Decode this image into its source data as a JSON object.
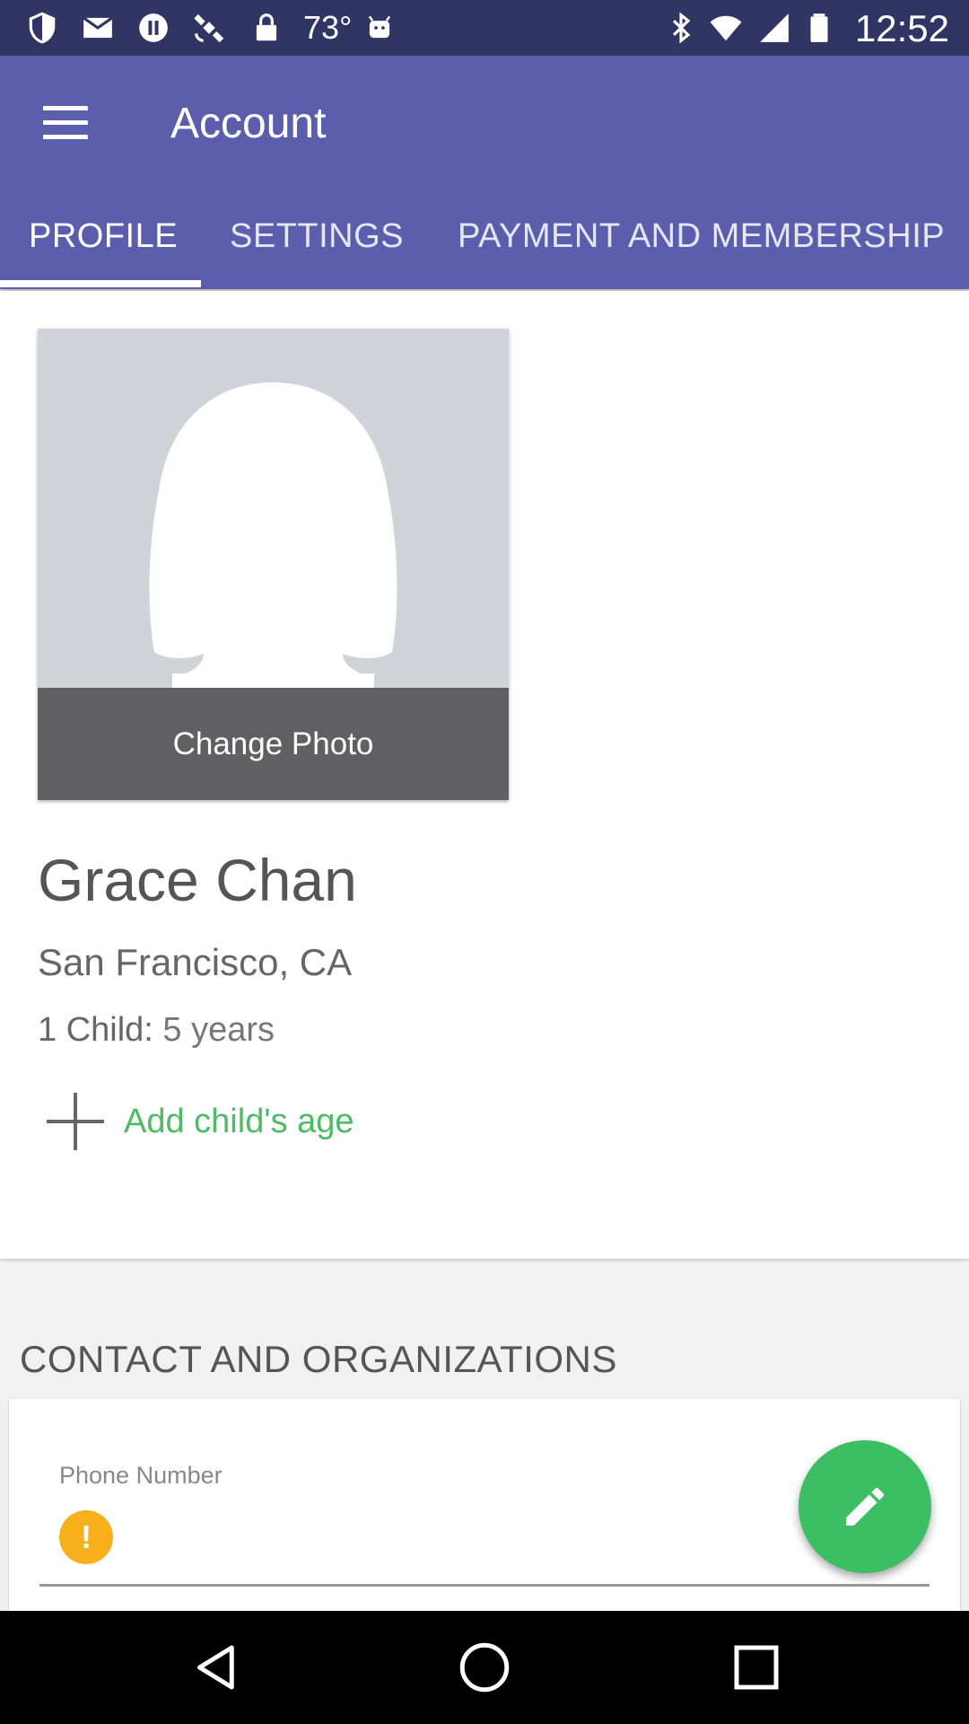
{
  "status_bar": {
    "temperature": "73°",
    "time": "12:52",
    "icons": [
      "shield-icon",
      "gmail-icon",
      "pause-circle-icon",
      "satellite-icon",
      "lock-icon",
      "android-icon",
      "bluetooth-icon",
      "wifi-icon",
      "signal-icon",
      "battery-icon"
    ]
  },
  "app_bar": {
    "title": "Account",
    "menu_icon": "hamburger-menu-icon",
    "background": "#5b5ead"
  },
  "tabs": [
    {
      "label": "PROFILE",
      "active": true
    },
    {
      "label": "SETTINGS",
      "active": false
    },
    {
      "label": "PAYMENT AND MEMBERSHIP",
      "active": false
    }
  ],
  "profile": {
    "change_photo_label": "Change Photo",
    "name": "Grace Chan",
    "location": "San Francisco, CA",
    "child_label": "1 Child:",
    "child_age": " 5 years",
    "add_child_label": "Add child's age"
  },
  "contact": {
    "section_title": "CONTACT AND ORGANIZATIONS",
    "phone_label": "Phone Number",
    "phone_value": "",
    "warning_icon": "!",
    "edit_icon": "pencil-icon"
  },
  "nav_bar": {
    "buttons": [
      "back-icon",
      "home-icon",
      "recents-icon"
    ]
  },
  "colors": {
    "accent_green": "#3cbe63",
    "link_green": "#4cbb63",
    "warning": "#f7b01c",
    "status_bar": "#303564"
  }
}
